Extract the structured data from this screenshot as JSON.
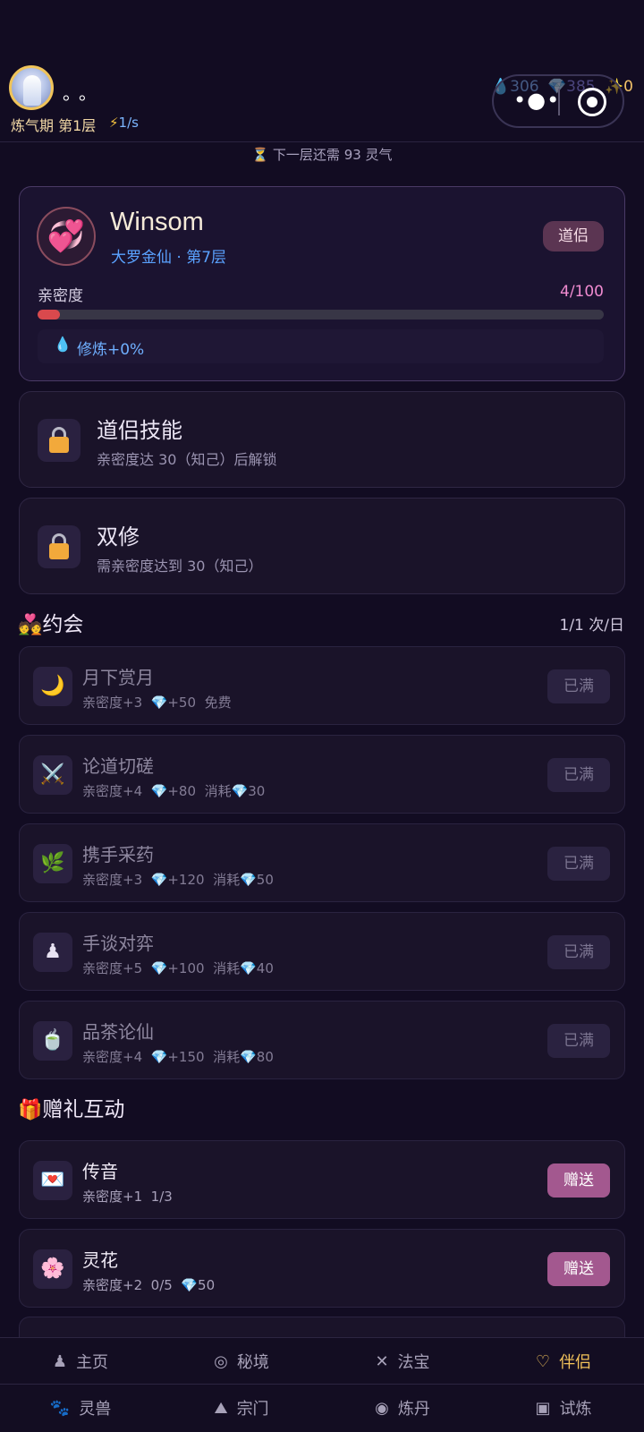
{
  "header": {
    "nickname": "。。",
    "realm": "炼气期 第1层",
    "speed": "1/s",
    "resources": {
      "water": "306",
      "gem": "385",
      "spark": "0"
    },
    "next_layer": "下一层还需 93 灵气"
  },
  "partner": {
    "name": "Winsom",
    "realm": "大罗金仙 · 第7层",
    "tag": "道侣",
    "intimacy_label": "亲密度",
    "intimacy_value": "4/100",
    "intimacy_fraction": 0.04,
    "bonus": "修炼+0%"
  },
  "locked": [
    {
      "title": "道侣技能",
      "sub": "亲密度达 30（知己）后解锁"
    },
    {
      "title": "双修",
      "sub": "需亲密度达到 30（知己）"
    }
  ],
  "dates": {
    "title": "约会",
    "count": "1/1 次/日",
    "items": [
      {
        "icon": "🌙",
        "title": "月下赏月",
        "intimacy": "亲密度+3",
        "gem": "+50",
        "cost": "免费",
        "button": "已满"
      },
      {
        "icon": "⚔️",
        "title": "论道切磋",
        "intimacy": "亲密度+4",
        "gem": "+80",
        "cost": "消耗💎30",
        "button": "已满"
      },
      {
        "icon": "🌿",
        "title": "携手采药",
        "intimacy": "亲密度+3",
        "gem": "+120",
        "cost": "消耗💎50",
        "button": "已满"
      },
      {
        "icon": "♟",
        "title": "手谈对弈",
        "intimacy": "亲密度+5",
        "gem": "+100",
        "cost": "消耗💎40",
        "button": "已满"
      },
      {
        "icon": "🍵",
        "title": "品茶论仙",
        "intimacy": "亲密度+4",
        "gem": "+150",
        "cost": "消耗💎80",
        "button": "已满"
      }
    ]
  },
  "gifts": {
    "title": "赠礼互动",
    "items": [
      {
        "icon": "💌",
        "title": "传音",
        "intimacy": "亲密度+1",
        "progress": "1/3",
        "cost": "",
        "button": "赠送"
      },
      {
        "icon": "🌸",
        "title": "灵花",
        "intimacy": "亲密度+2",
        "progress": "0/5",
        "cost": "50",
        "button": "赠送"
      }
    ]
  },
  "nav": [
    {
      "icon": "♟",
      "label": "主页",
      "active": false
    },
    {
      "icon": "◎",
      "label": "秘境",
      "active": false
    },
    {
      "icon": "✕",
      "label": "法宝",
      "active": false
    },
    {
      "icon": "♡",
      "label": "伴侣",
      "active": true
    },
    {
      "icon": "🐾",
      "label": "灵兽",
      "active": false
    },
    {
      "icon": "⛰",
      "label": "宗门",
      "active": false
    },
    {
      "icon": "◉",
      "label": "炼丹",
      "active": false
    },
    {
      "icon": "▣",
      "label": "试炼",
      "active": false
    }
  ]
}
